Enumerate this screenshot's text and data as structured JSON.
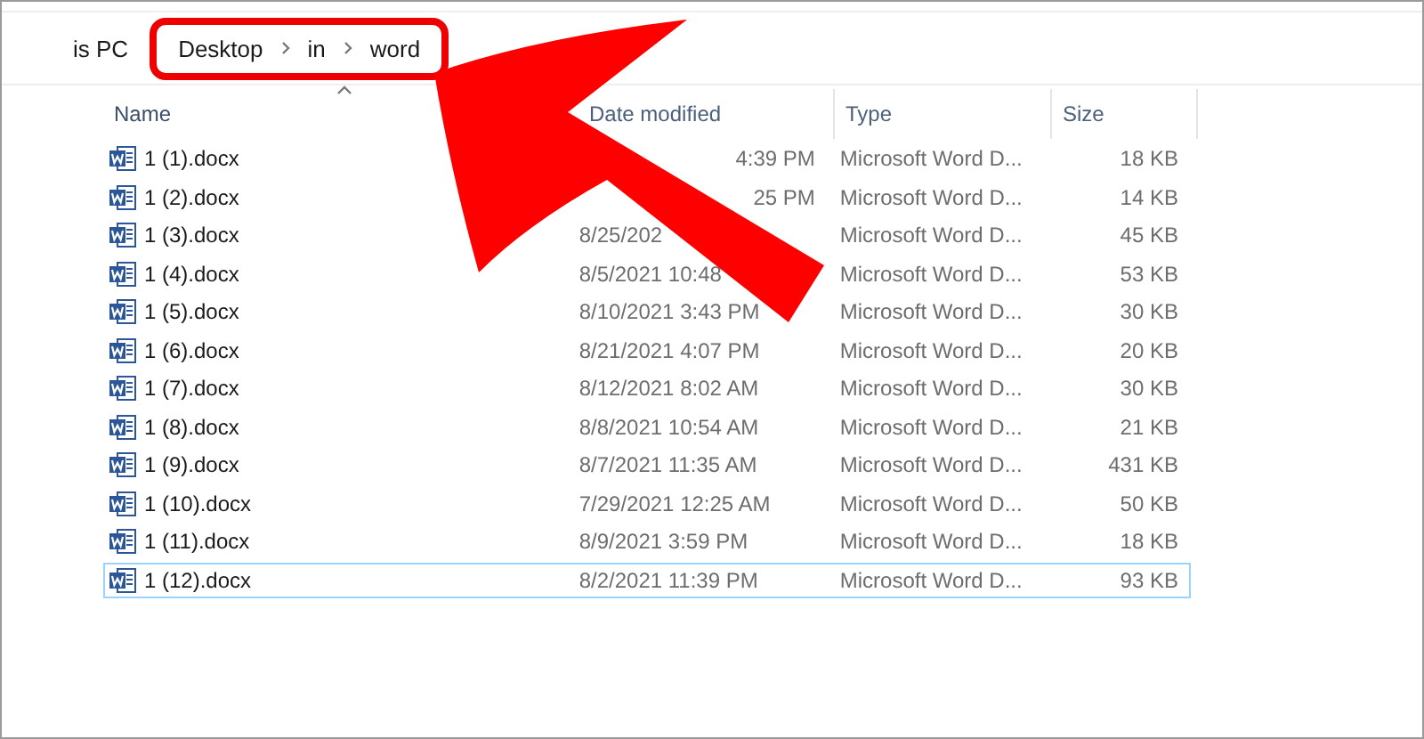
{
  "address_bar": {
    "root": "is PC",
    "highlighted": true,
    "path": [
      {
        "label": "Desktop"
      },
      {
        "label": "in"
      },
      {
        "label": "word"
      }
    ]
  },
  "columns": [
    {
      "label": "Name",
      "sorted": true
    },
    {
      "label": "Date modified",
      "sorted": false
    },
    {
      "label": "Type",
      "sorted": false
    },
    {
      "label": "Size",
      "sorted": false
    }
  ],
  "files": [
    {
      "name": "1 (1).docx",
      "date_modified": "4:39 PM",
      "date_start_hidden": true,
      "type": "Microsoft Word D...",
      "size": "18 KB",
      "selected": false
    },
    {
      "name": "1 (2).docx",
      "date_modified": "25 PM",
      "date_start_hidden": true,
      "type": "Microsoft Word D...",
      "size": "14 KB",
      "selected": false
    },
    {
      "name": "1 (3).docx",
      "date_modified": "8/25/202",
      "date_start_hidden": false,
      "type": "Microsoft Word D...",
      "size": "45 KB",
      "selected": false
    },
    {
      "name": "1 (4).docx",
      "date_modified": "8/5/2021 10:48",
      "date_start_hidden": false,
      "type": "Microsoft Word D...",
      "size": "53 KB",
      "selected": false
    },
    {
      "name": "1 (5).docx",
      "date_modified": "8/10/2021 3:43 PM",
      "date_start_hidden": false,
      "type": "Microsoft Word D...",
      "size": "30 KB",
      "selected": false
    },
    {
      "name": "1 (6).docx",
      "date_modified": "8/21/2021 4:07 PM",
      "date_start_hidden": false,
      "type": "Microsoft Word D...",
      "size": "20 KB",
      "selected": false
    },
    {
      "name": "1 (7).docx",
      "date_modified": "8/12/2021 8:02 AM",
      "date_start_hidden": false,
      "type": "Microsoft Word D...",
      "size": "30 KB",
      "selected": false
    },
    {
      "name": "1 (8).docx",
      "date_modified": "8/8/2021 10:54 AM",
      "date_start_hidden": false,
      "type": "Microsoft Word D...",
      "size": "21 KB",
      "selected": false
    },
    {
      "name": "1 (9).docx",
      "date_modified": "8/7/2021 11:35 AM",
      "date_start_hidden": false,
      "type": "Microsoft Word D...",
      "size": "431 KB",
      "selected": false
    },
    {
      "name": "1 (10).docx",
      "date_modified": "7/29/2021 12:25 AM",
      "date_start_hidden": false,
      "type": "Microsoft Word D...",
      "size": "50 KB",
      "selected": false
    },
    {
      "name": "1 (11).docx",
      "date_modified": "8/9/2021 3:59 PM",
      "date_start_hidden": false,
      "type": "Microsoft Word D...",
      "size": "18 KB",
      "selected": false
    },
    {
      "name": "1 (12).docx",
      "date_modified": "8/2/2021 11:39 PM",
      "date_start_hidden": false,
      "type": "Microsoft Word D...",
      "size": "93 KB",
      "selected": true
    }
  ],
  "annotation": {
    "kind": "arrow"
  }
}
